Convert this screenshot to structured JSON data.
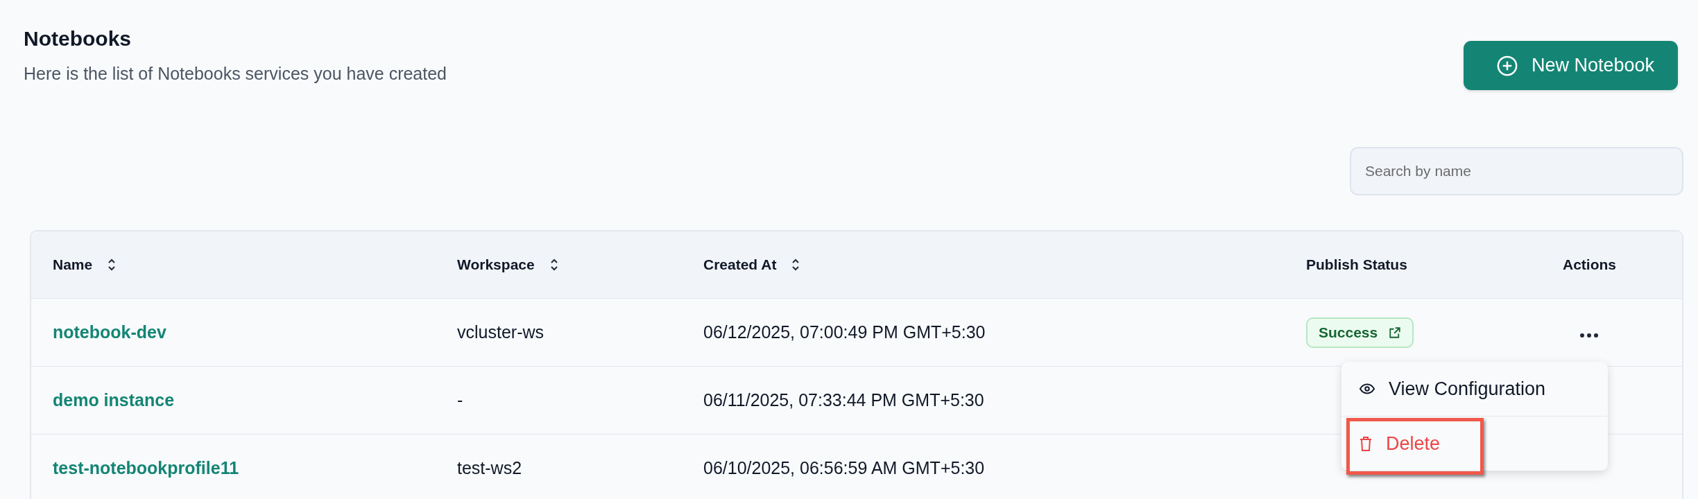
{
  "header": {
    "title": "Notebooks",
    "subtitle": "Here is the list of Notebooks services you have created",
    "new_button": "New Notebook"
  },
  "search": {
    "placeholder": "Search by name"
  },
  "table": {
    "columns": [
      {
        "label": "Name",
        "sortable": true
      },
      {
        "label": "Workspace",
        "sortable": true
      },
      {
        "label": "Created At",
        "sortable": true
      },
      {
        "label": "Publish Status",
        "sortable": false
      },
      {
        "label": "Actions",
        "sortable": false
      }
    ],
    "rows": [
      {
        "name": "notebook-dev",
        "workspace": "vcluster-ws",
        "created_at": "06/12/2025, 07:00:49 PM GMT+5:30",
        "status": {
          "label": "Success",
          "kind": "success"
        }
      },
      {
        "name": "demo instance",
        "workspace": "-",
        "created_at": "06/11/2025, 07:33:44 PM GMT+5:30"
      },
      {
        "name": "test-notebookprofile11",
        "workspace": "test-ws2",
        "created_at": "06/10/2025, 06:56:59 AM GMT+5:30"
      }
    ]
  },
  "action_menu": {
    "items": [
      {
        "label": "View Configuration",
        "kind": "view",
        "highlighted": false
      },
      {
        "label": "Delete",
        "kind": "delete",
        "highlighted": true
      }
    ]
  }
}
